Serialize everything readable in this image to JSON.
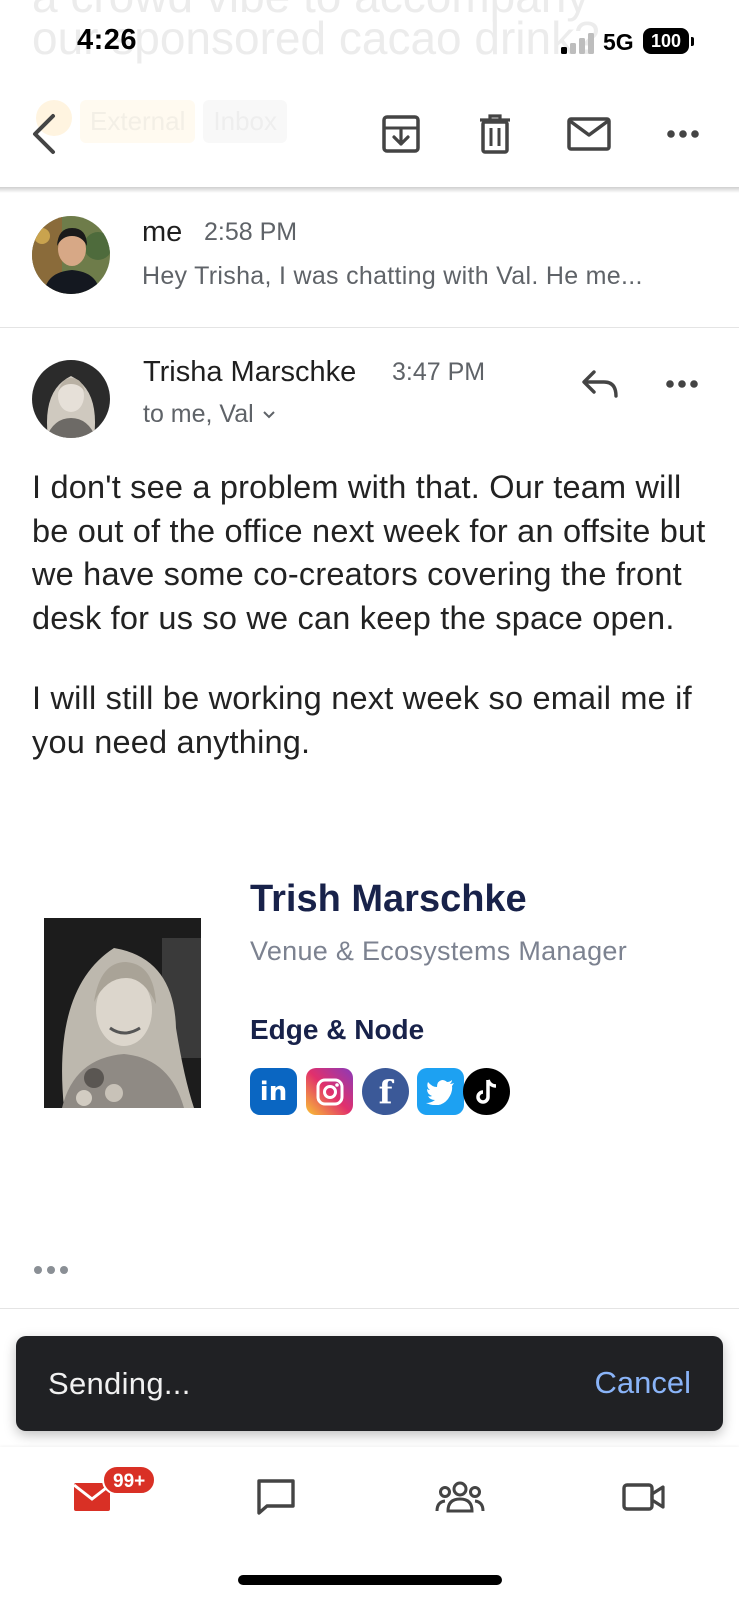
{
  "status_bar": {
    "time": "4:26",
    "network": "5G",
    "battery": "100"
  },
  "subject_background": {
    "line1": "a crowd vibe to accompany",
    "line2": "our sponsored cacao drink?",
    "labels": [
      "External",
      "Inbox"
    ]
  },
  "toolbar": {
    "icons": [
      "back-icon",
      "archive-icon",
      "delete-icon",
      "mark-unread-icon",
      "more-icon"
    ]
  },
  "thread": {
    "collapsed_message": {
      "from": "me",
      "time": "2:58 PM",
      "snippet": "Hey Trisha, I was chatting with Val. He me..."
    },
    "expanded_message": {
      "from": "Trisha Marschke",
      "time": "3:47 PM",
      "to": "to me, Val",
      "body": [
        "I don't see a problem with that.  Our team will be out of the office next week for an offsite but we have some co-creators covering the front desk for us so we can keep the space open.",
        "I will still be working next week so email me if you need anything."
      ],
      "signature": {
        "name": "Trish Marschke",
        "title": "Venue & Ecosystems Manager",
        "company": "Edge & Node",
        "socials": [
          "linkedin",
          "instagram",
          "facebook",
          "twitter",
          "tiktok"
        ]
      }
    }
  },
  "snackbar": {
    "text": "Sending...",
    "action": "Cancel"
  },
  "bottom_nav": {
    "items": [
      "mail",
      "chat",
      "spaces",
      "meet"
    ],
    "mail_badge": "99+",
    "accent": "#d93025"
  }
}
